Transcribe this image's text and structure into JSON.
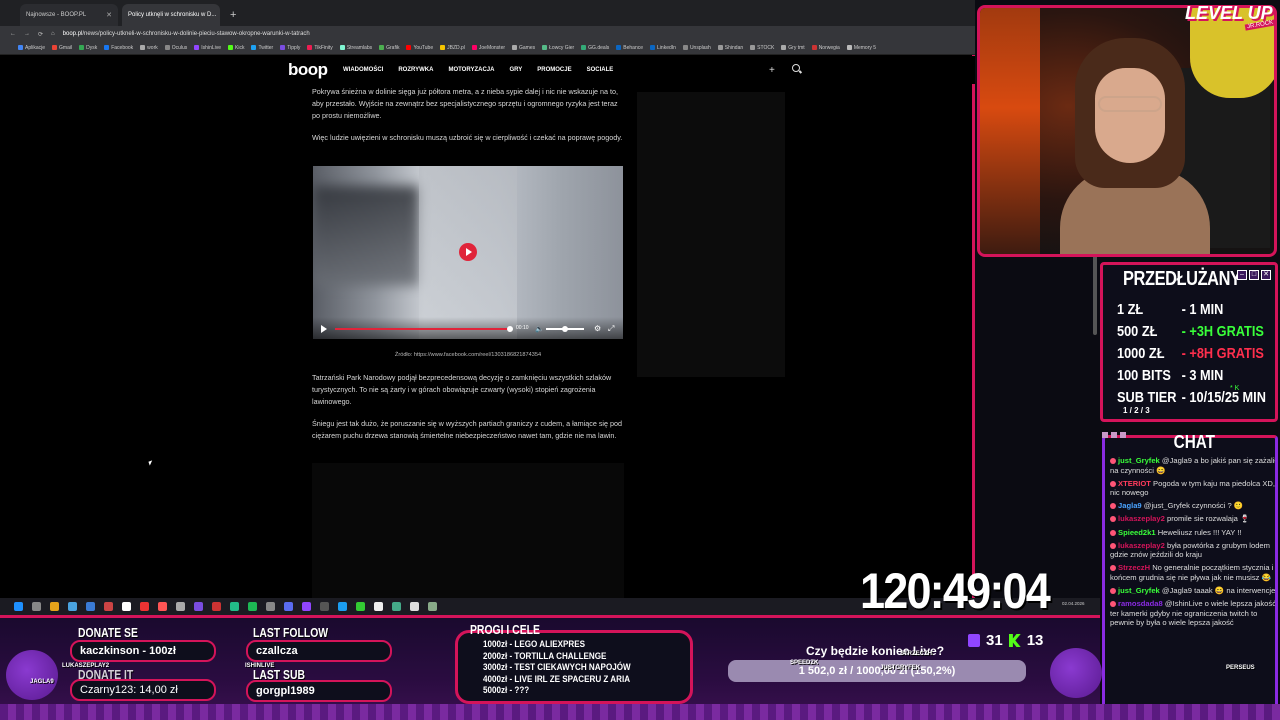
{
  "browser": {
    "tabs": [
      {
        "label": "Najnowsze - BOOP.PL",
        "active": false
      },
      {
        "label": "Policy utknęli w schronisku w D...",
        "active": true
      }
    ],
    "url_domain": "boop.pl",
    "url_path": "/news/policy-utkneli-w-schronisku-w-dolinie-pieciu-stawow-okropne-warunki-w-tatrach",
    "bookmarks": [
      "Aplikacje",
      "Gmail",
      "Dysk",
      "Facebook",
      "work",
      "Oculus",
      "IshinLive",
      "Kick",
      "Twitter",
      "Tipply",
      "TikFinity",
      "Streamlabs",
      "Grafik",
      "YouTube",
      "JBZD.pl",
      "JoeMonster",
      "Games",
      "Łowcy Gier",
      "GG.deals",
      "Behance",
      "LinkedIn",
      "Unsplash",
      "Shindan",
      "STOCK",
      "Gry tmt",
      "Norwegia",
      "Memory 5"
    ]
  },
  "site": {
    "logo": "boop",
    "nav": [
      "WIADOMOŚCI",
      "ROZRYWKA",
      "MOTORYZACJA",
      "GRY",
      "PROMOCJE",
      "SOCIALE"
    ]
  },
  "article": {
    "p1": "Pokrywa śnieżna w dolinie sięga już półtora metra, a z nieba sypie dalej i nic nie wskazuje na to, aby przestało. Wyjście na zewnątrz bez specjalistycznego sprzętu i ogromnego ryzyka jest teraz po prostu niemożliwe.",
    "p2": "Więc ludzie uwięzieni w schronisku muszą uzbroić się w cierpliwość i czekać na poprawę pogody.",
    "video_time": "00:10",
    "caption": "Źródło: https://www.facebook.com/reel/1303186821874354",
    "p3": "Tatrzański Park Narodowy podjął bezprecedensową decyzję o zamknięciu wszystkich szlaków turystycznych. To nie są żarty i w górach obowiązuje czwarty (wysoki) stopień zagrożenia lawinowego.",
    "p4": "Śniegu jest tak dużo, że poruszanie się w wyższych partiach graniczy z cudem, a łamiące się pod ciężarem puchu drzewa stanowią śmiertelne niebezpieczeństwo nawet tam, gdzie nie ma lawin."
  },
  "taskbar": {
    "icon_colors": [
      "#1e90ff",
      "#888",
      "#e3a21a",
      "#4aa3df",
      "#3a7bd5",
      "#c44",
      "#fff",
      "#e33",
      "#f55",
      "#aaa",
      "#7a4de0",
      "#c33",
      "#2b8",
      "#1db954",
      "#888",
      "#5a6cf0",
      "#9146ff",
      "#555",
      "#1b9df0",
      "#3c3",
      "#eee",
      "#4a8",
      "#ddd",
      "#8a8"
    ],
    "clock": "02.04.2026"
  },
  "overlay": {
    "level_up": "LEVEL UP",
    "level_up_sub": "JR.ROCK",
    "subathon": {
      "title": "PRZEDŁUŻANY",
      "rows": [
        {
          "k": "1 ZŁ",
          "v": "- 1 MIN",
          "cls": ""
        },
        {
          "k": "500 ZŁ",
          "v": "- +3H GRATIS",
          "cls": "g"
        },
        {
          "k": "1000 ZŁ",
          "v": "- +8H GRATIS",
          "cls": "r"
        },
        {
          "k": "100 BITS",
          "v": "- 3 MIN",
          "cls": ""
        },
        {
          "k": "SUB TIER",
          "v": "- 10/15/25 MIN",
          "cls": ""
        }
      ],
      "tiers": "1 / 2 / 3",
      "stars": "* K"
    },
    "chat": {
      "title": "CHAT",
      "messages": [
        {
          "user": "just_Gryfek",
          "color": "#39ff3a",
          "text": "@Jagla9 a bo jakiś pan się zażalił na czynności 😄"
        },
        {
          "user": "XTERIOT",
          "color": "#ff3b5c",
          "text": "Pogoda w tym kaju ma piedolca XD, nic nowego"
        },
        {
          "user": "Jagla9",
          "color": "#4aa3ff",
          "text": "@just_Gryfek czynności ? 🙂"
        },
        {
          "user": "lukaszeplay2",
          "color": "#d4145a",
          "text": "promile sie rozwalaja 🍷"
        },
        {
          "user": "Spieed2k1",
          "color": "#39ff3a",
          "text": "Heweliusz rules !!! YAY !!"
        },
        {
          "user": "lukaszeplay2",
          "color": "#d4145a",
          "text": "była powtórka z grubym lodem gdzie znów jeździli do kraju"
        },
        {
          "user": "StrzeczH",
          "color": "#d4145a",
          "text": "No generalnie początkiem stycznia i końcem grudnia się nie pływa jak nie musisz 😂"
        },
        {
          "user": "just_Gryfek",
          "color": "#39ff3a",
          "text": "@Jagla9 taaak 😄 na interwencje"
        },
        {
          "user": "ramosdada8",
          "color": "#8a2be2",
          "text": "@IshinLive o wiele lepsza jakość ter kamerki gdyby nie ograniczenia twitch to pewnie by była o wiele lepsza jakość"
        }
      ]
    },
    "timer": "120:49:04",
    "viewers_twitch": "31",
    "viewers_kick": "13",
    "donate_label": "DONATE SE",
    "donate_top": "kaczkinson - 100zł",
    "donate_label2": "DONATE IT",
    "donate_last": "Czarny123: 14,00 zł",
    "last_follow_label": "LAST FOLLOW",
    "last_follow": "czallcza",
    "last_sub_label": "LAST SUB",
    "last_sub": "gorgpl1989",
    "goals": {
      "title": "PROGI I CELE",
      "items": [
        "1000zł - LEGO ALIEXPRES",
        "2000zł - TORTILLA CHALLENGE",
        "3000zł - TEST CIEKAWYCH NAPOJÓW",
        "4000zł - LIVE IRL ZE SPACERU Z ARIA",
        "5000zł - ???"
      ]
    },
    "end_question": "Czy będzie koniec Live?",
    "end_bar": "1 502,0 zł / 1000,00 zł (150,2%)",
    "sprites": [
      "LUKASZEPLAY2",
      "JAGLA9",
      "ISHINLIVE",
      "SPEEDZK",
      "STRZECZH",
      "JUSTGRYFEK",
      "PERSEUS"
    ]
  }
}
